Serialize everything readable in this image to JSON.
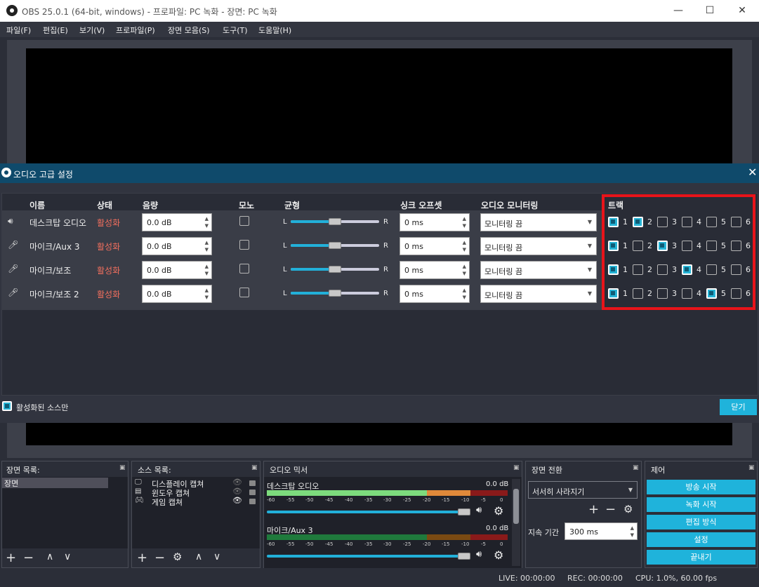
{
  "window": {
    "title": "OBS 25.0.1 (64-bit, windows) - 프로파일: PC 녹화 - 장면: PC 녹화"
  },
  "menu": [
    "파일(F)",
    "편집(E)",
    "보기(V)",
    "프로파일(P)",
    "장면 모음(S)",
    "도구(T)",
    "도움말(H)"
  ],
  "dialog": {
    "title": "오디오 고급 설정",
    "headers": {
      "name": "이름",
      "status": "상태",
      "volume": "음량",
      "mono": "모노",
      "balance": "균형",
      "sync": "싱크 오프셋",
      "monitoring": "오디오 모니터링",
      "tracks": "트랙"
    },
    "rows": [
      {
        "name": "데스크탑 오디오",
        "icon": "speaker-icon",
        "status": "활성화",
        "volume": "0.0 dB",
        "mono": false,
        "balance_left": "L",
        "balance_right": "R",
        "balance": 0.5,
        "sync": "0 ms",
        "monitoring": "모니터링 끔",
        "tracks": [
          true,
          true,
          false,
          false,
          false,
          false
        ]
      },
      {
        "name": "마이크/Aux 3",
        "icon": "microphone-icon",
        "status": "활성화",
        "volume": "0.0 dB",
        "mono": false,
        "balance_left": "L",
        "balance_right": "R",
        "balance": 0.5,
        "sync": "0 ms",
        "monitoring": "모니터링 끔",
        "tracks": [
          true,
          false,
          true,
          false,
          false,
          false
        ]
      },
      {
        "name": "마이크/보조",
        "icon": "microphone-icon",
        "status": "활성화",
        "volume": "0.0 dB",
        "mono": false,
        "balance_left": "L",
        "balance_right": "R",
        "balance": 0.5,
        "sync": "0 ms",
        "monitoring": "모니터링 끔",
        "tracks": [
          true,
          false,
          false,
          true,
          false,
          false
        ]
      },
      {
        "name": "마이크/보조 2",
        "icon": "microphone-icon",
        "status": "활성화",
        "volume": "0.0 dB",
        "mono": false,
        "balance_left": "L",
        "balance_right": "R",
        "balance": 0.5,
        "sync": "0 ms",
        "monitoring": "모니터링 끔",
        "tracks": [
          true,
          false,
          false,
          false,
          true,
          false
        ]
      }
    ],
    "track_labels": [
      "1",
      "2",
      "3",
      "4",
      "5",
      "6"
    ],
    "active_only_label": "활성화된 소스만",
    "active_only": true,
    "close_label": "닫기"
  },
  "docks": {
    "scenes": {
      "title": "장면 목록:",
      "items": [
        "장면"
      ]
    },
    "sources": {
      "title": "소스 목록:",
      "items": [
        {
          "label": "디스플레이 캡쳐",
          "icon": "monitor-icon",
          "visible": false
        },
        {
          "label": "윈도우 캡쳐",
          "icon": "window-icon",
          "visible": false
        },
        {
          "label": "게임 캡쳐",
          "icon": "gamepad-icon",
          "visible": true
        }
      ]
    },
    "mixer": {
      "title": "오디오 믹서",
      "channels": [
        {
          "name": "데스크탑 오디오",
          "level": "0.0 dB"
        },
        {
          "name": "마이크/Aux 3",
          "level": "0.0 dB"
        }
      ],
      "scale": [
        "-60",
        "-55",
        "-50",
        "-45",
        "-40",
        "-35",
        "-30",
        "-25",
        "-20",
        "-15",
        "-10",
        "-5",
        "0"
      ]
    },
    "transitions": {
      "title": "장면 전환",
      "selected": "서서히 사라지기",
      "duration_label": "지속 기간",
      "duration": "300 ms"
    },
    "controls": {
      "title": "제어",
      "buttons": [
        "방송 시작",
        "녹화 시작",
        "편집 방식",
        "설정",
        "끝내기"
      ]
    }
  },
  "status": {
    "live": "LIVE: 00:00:00",
    "rec": "REC: 00:00:00",
    "cpu": "CPU: 1.0%, 60.00 fps"
  },
  "colors": {
    "accent": "#1fb3db",
    "status_active": "#f26f5e",
    "highlight_box": "#e8141a",
    "dialog_title": "#0f4a6b"
  }
}
